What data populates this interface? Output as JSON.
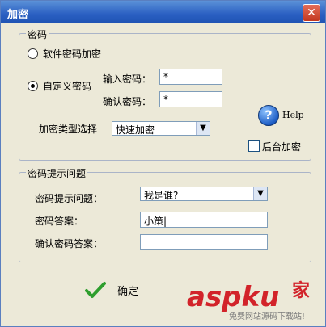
{
  "window": {
    "title": "加密",
    "close_glyph": "✕"
  },
  "password_group": {
    "title": "密码",
    "option_software": "软件密码加密",
    "option_custom": "自定义密码",
    "enter_label": "输入密码：",
    "enter_value": "*",
    "confirm_label": "确认密码：",
    "confirm_value": "*",
    "type_label": "加密类型选择",
    "type_value": "快速加密",
    "help_label": "Help",
    "background_label": "后台加密"
  },
  "hint_group": {
    "title": "密码提示问题",
    "question_label": "密码提示问题：",
    "question_value": "我是谁?",
    "answer_label": "密码答案：",
    "answer_value": "小策|",
    "confirm_answer_label": "确认密码答案：",
    "confirm_answer_value": ""
  },
  "footer": {
    "ok_label": "确定"
  },
  "watermark": {
    "text": "aspku",
    "suffix": "家",
    "subtext": "免费网站源码下载站!"
  },
  "colors": {
    "title_bar": "#2a5fc2",
    "ok_check": "#2e9e2e",
    "watermark": "#d2232a"
  }
}
